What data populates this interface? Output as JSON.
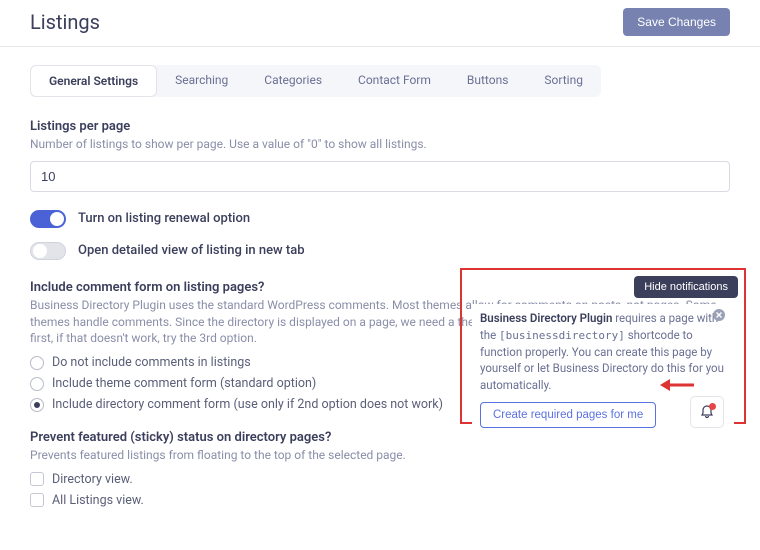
{
  "header": {
    "title": "Listings",
    "save_label": "Save Changes"
  },
  "tabs": [
    {
      "label": "General Settings",
      "active": true
    },
    {
      "label": "Searching",
      "active": false
    },
    {
      "label": "Categories",
      "active": false
    },
    {
      "label": "Contact Form",
      "active": false
    },
    {
      "label": "Buttons",
      "active": false
    },
    {
      "label": "Sorting",
      "active": false
    }
  ],
  "listings_per_page": {
    "label": "Listings per page",
    "desc": "Number of listings to show per page. Use a value of \"0\" to show all listings.",
    "value": "10"
  },
  "toggles": {
    "renewal": "Turn on listing renewal option",
    "new_tab": "Open detailed view of listing in new tab"
  },
  "comment_form": {
    "label": "Include comment form on listing pages?",
    "desc": "Business Directory Plugin uses the standard WordPress comments. Most themes allow for comments on posts, not pages. Some themes handle comments. Since the directory is displayed on a page, we need a theme that can handle both. Use the 2nd option first, if that doesn't work, try the 3rd option.",
    "options": [
      "Do not include comments in listings",
      "Include theme comment form (standard option)",
      "Include directory comment form (use only if 2nd option does not work)"
    ],
    "selected": 2
  },
  "sticky": {
    "label": "Prevent featured (sticky) status on directory pages?",
    "desc": "Prevents featured listings from floating to the top of the selected page.",
    "options": [
      "Directory view.",
      "All Listings view."
    ]
  },
  "notification": {
    "hide_label": "Hide notifications",
    "strong": "Business Directory Plugin",
    "text1": " requires a page with the ",
    "code": "[businessdirectory]",
    "text2": " shortcode to function properly. You can create this page by yourself or let Business Directory do this for you automatically.",
    "button": "Create required pages for me"
  }
}
